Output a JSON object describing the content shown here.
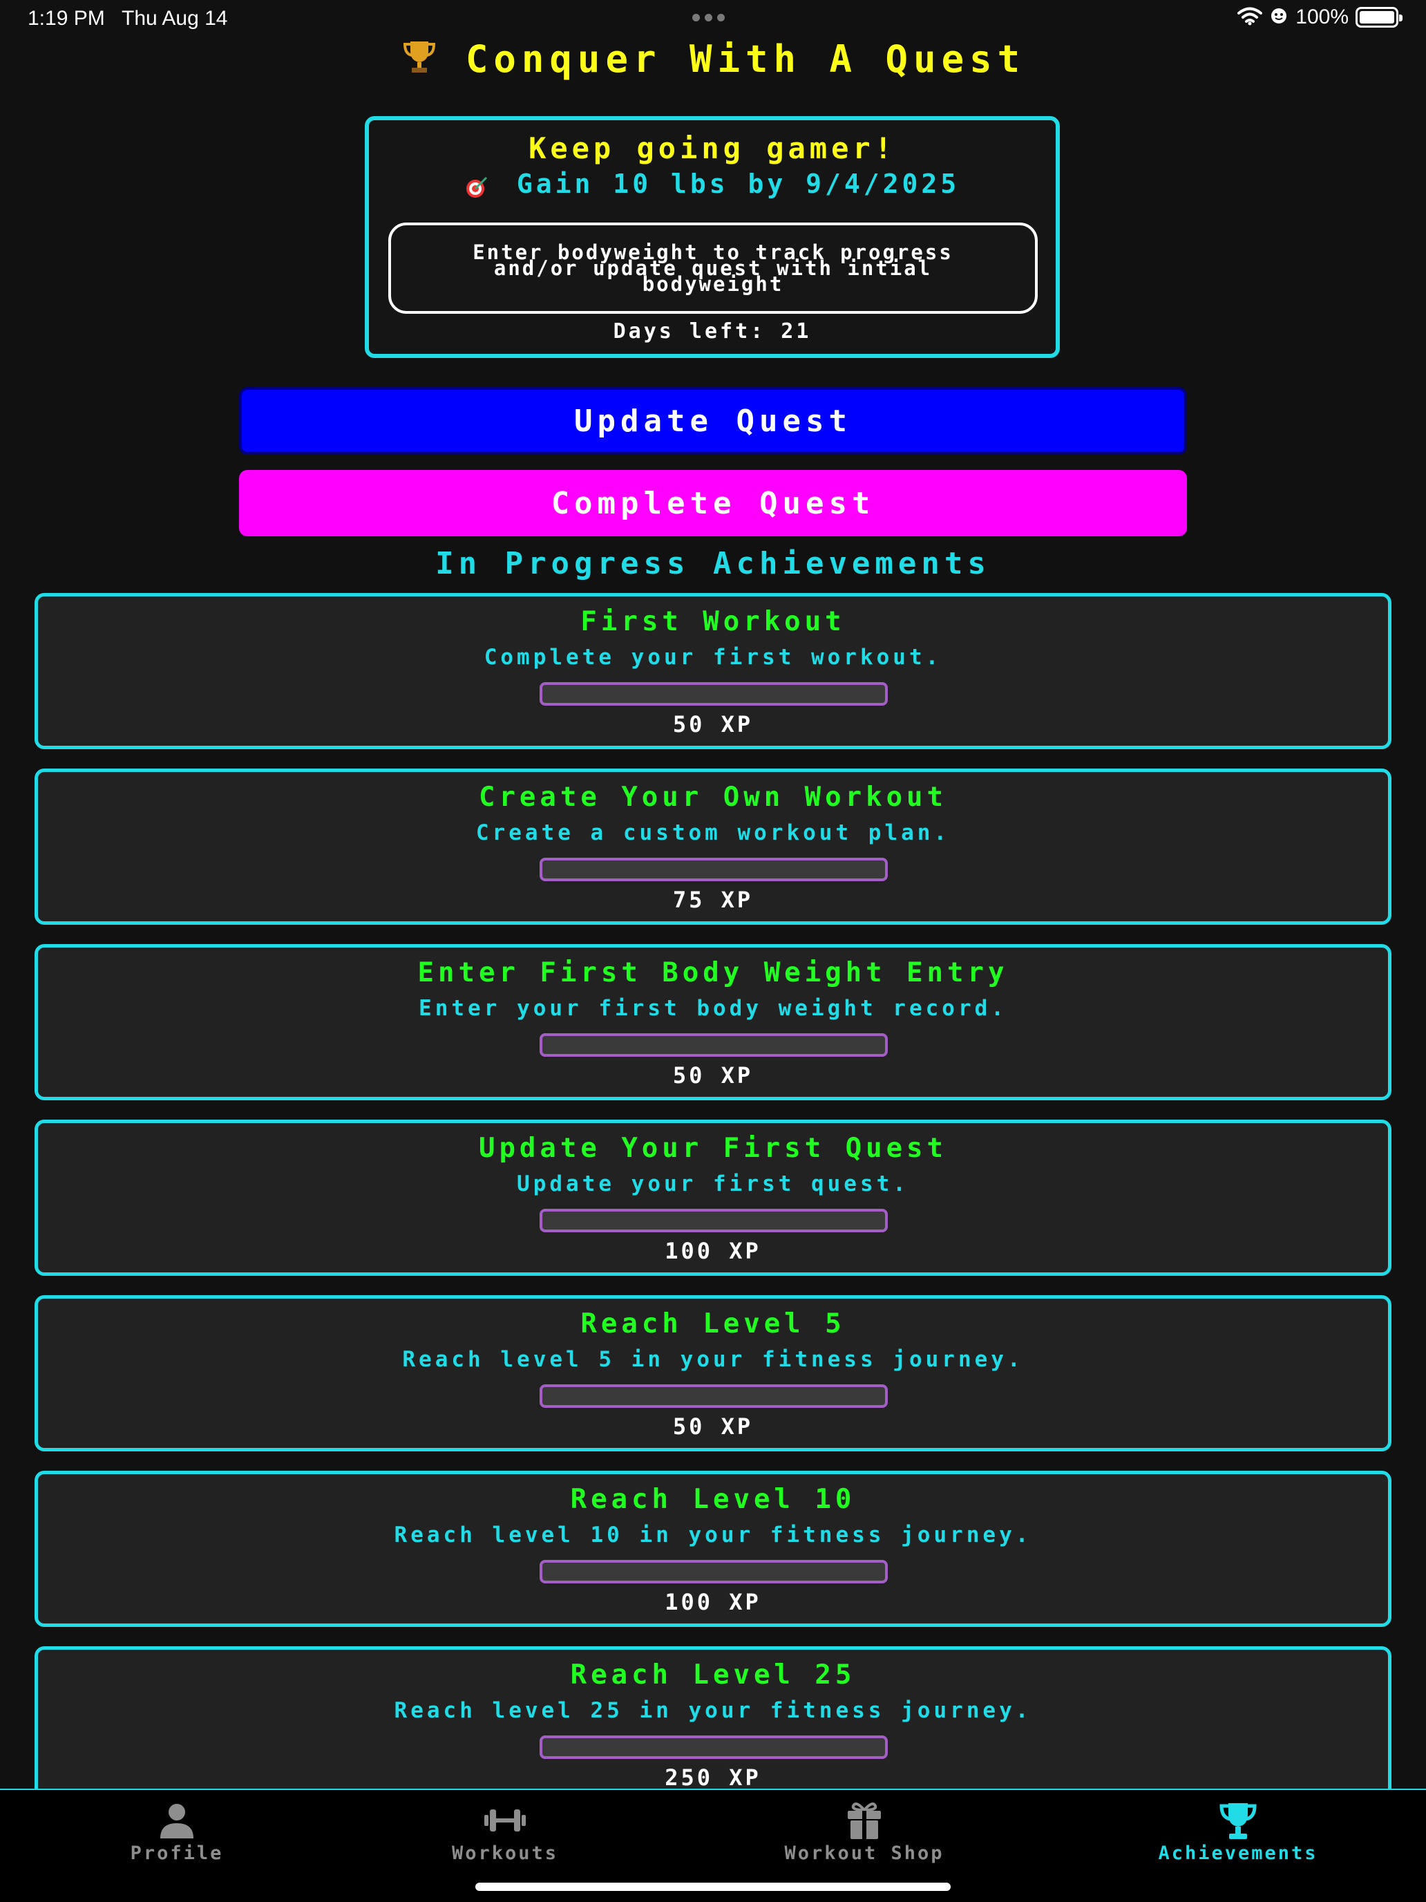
{
  "status_bar": {
    "time": "1:19 PM",
    "date": "Thu Aug 14",
    "battery": "100%"
  },
  "header": {
    "title": "Conquer With A Quest",
    "icon": "trophy-icon"
  },
  "quest": {
    "heading": "Keep going gamer!",
    "goal_icon": "target-icon",
    "goal": "Gain 10 lbs by 9/4/2025",
    "bodyweight_placeholder": "Enter bodyweight to track progress and/or update quest with intial bodyweight",
    "days_left": "Days left: 21"
  },
  "actions": {
    "update_label": "Update Quest",
    "complete_label": "Complete Quest"
  },
  "achievements": {
    "section_title": "In Progress Achievements",
    "items": [
      {
        "name": "First Workout",
        "description": "Complete your first workout.",
        "xp": "50 XP",
        "progress": 0
      },
      {
        "name": "Create Your Own Workout",
        "description": "Create a custom workout plan.",
        "xp": "75 XP",
        "progress": 0
      },
      {
        "name": "Enter First Body Weight Entry",
        "description": "Enter your first body weight record.",
        "xp": "50 XP",
        "progress": 0
      },
      {
        "name": "Update Your First Quest",
        "description": "Update your first quest.",
        "xp": "100 XP",
        "progress": 0
      },
      {
        "name": "Reach Level 5",
        "description": "Reach level 5 in your fitness journey.",
        "xp": "50 XP",
        "progress": 0
      },
      {
        "name": "Reach Level 10",
        "description": "Reach level 10 in your fitness journey.",
        "xp": "100 XP",
        "progress": 0
      },
      {
        "name": "Reach Level 25",
        "description": "Reach level 25 in your fitness journey.",
        "xp": "250 XP",
        "progress": 0
      }
    ]
  },
  "tab_bar": {
    "tabs": [
      {
        "label": "Profile",
        "icon": "person-icon",
        "active": false
      },
      {
        "label": "Workouts",
        "icon": "dumbbell-icon",
        "active": false
      },
      {
        "label": "Workout Shop",
        "icon": "gift-icon",
        "active": false
      },
      {
        "label": "Achievements",
        "icon": "trophy-icon",
        "active": true
      }
    ]
  },
  "colors": {
    "accent_cyan": "#21dce6",
    "title_yellow": "#ffff1a",
    "achievement_green": "#21ff21",
    "update_blue": "#0000ff",
    "complete_magenta": "#ff00ff",
    "progress_purple": "#a45fc6"
  }
}
